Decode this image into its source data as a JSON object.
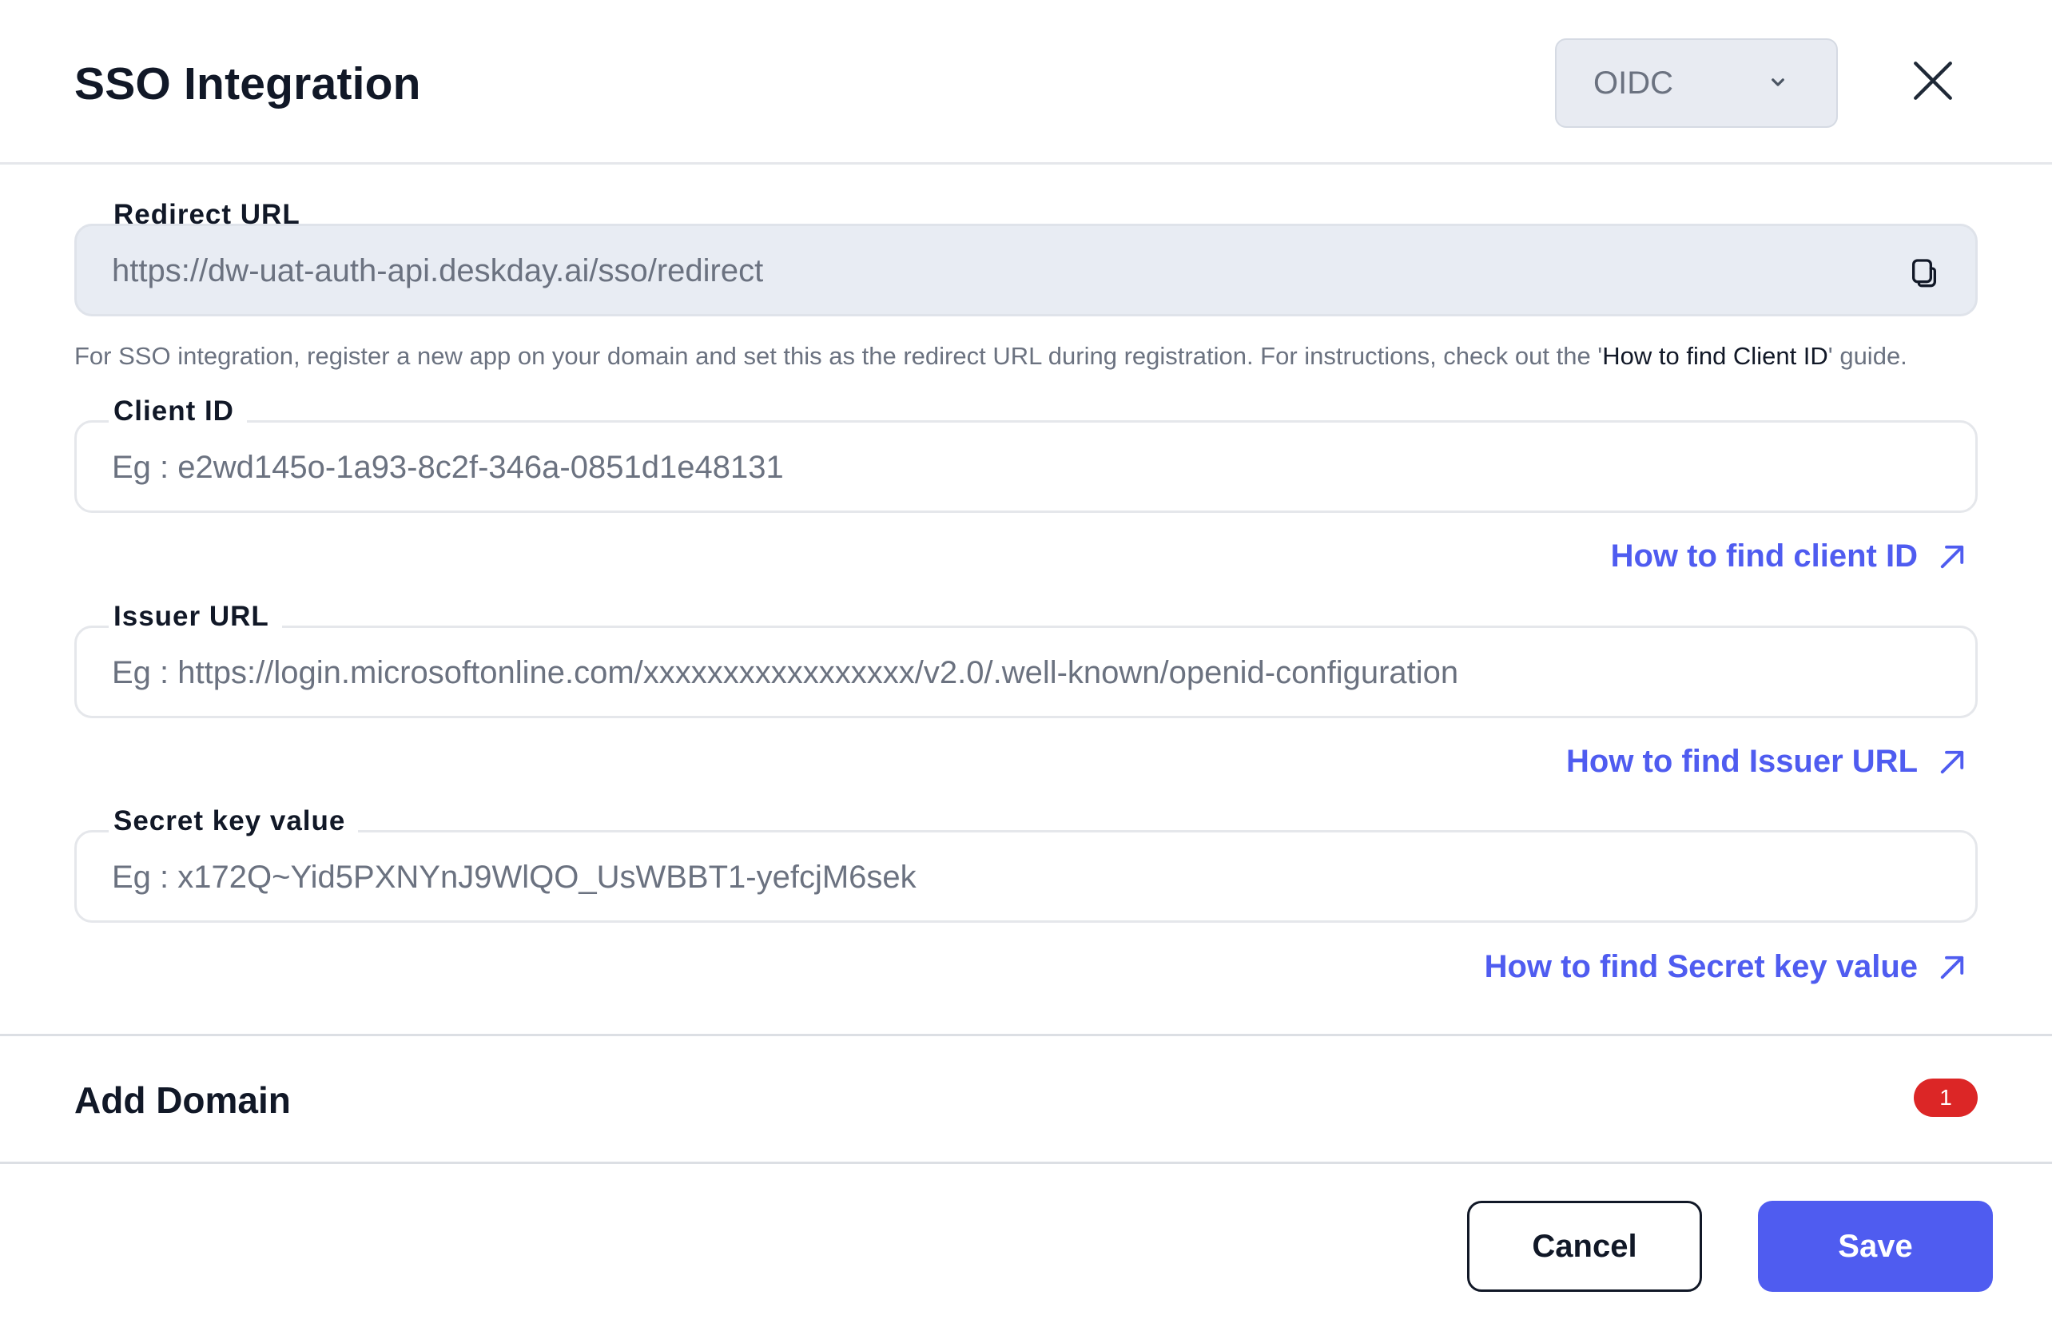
{
  "dialog": {
    "title": "SSO Integration",
    "protocol_select": {
      "value": "OIDC",
      "icon": "chevron-down-icon"
    },
    "close_icon": "close-icon"
  },
  "redirect_url": {
    "label": "Redirect URL",
    "value": "https://dw-uat-auth-api.deskday.ai/sso/redirect",
    "copy_icon": "copy-icon"
  },
  "help_text": {
    "before": "For SSO integration, register a new app on your domain and set this as the redirect URL during registration. For instructions, check out the '",
    "guide": "How to find Client ID",
    "after": "' guide."
  },
  "client_id": {
    "label": "Client ID",
    "placeholder": "Eg : e2wd145o-1a93-8c2f-346a-0851d1e48131",
    "value": "",
    "help_link": "How to find client ID"
  },
  "issuer_url": {
    "label": "Issuer URL",
    "placeholder": "Eg : https://login.microsoftonline.com/xxxxxxxxxxxxxxxxx/v2.0/.well-known/openid-configuration",
    "value": "",
    "help_link": "How to find Issuer URL"
  },
  "secret_key": {
    "label": "Secret key value",
    "placeholder": "Eg : x172Q~Yid5PXNYnJ9WlQO_UsWBBT1-yefcjM6sek",
    "value": "",
    "help_link": "How to find Secret key value"
  },
  "add_domain": {
    "title": "Add Domain",
    "count": "1"
  },
  "footer": {
    "cancel_label": "Cancel",
    "save_label": "Save"
  },
  "colors": {
    "accent": "#4f5cf0",
    "badge": "#dc2626",
    "readonly_bg": "#e8ecf3"
  }
}
